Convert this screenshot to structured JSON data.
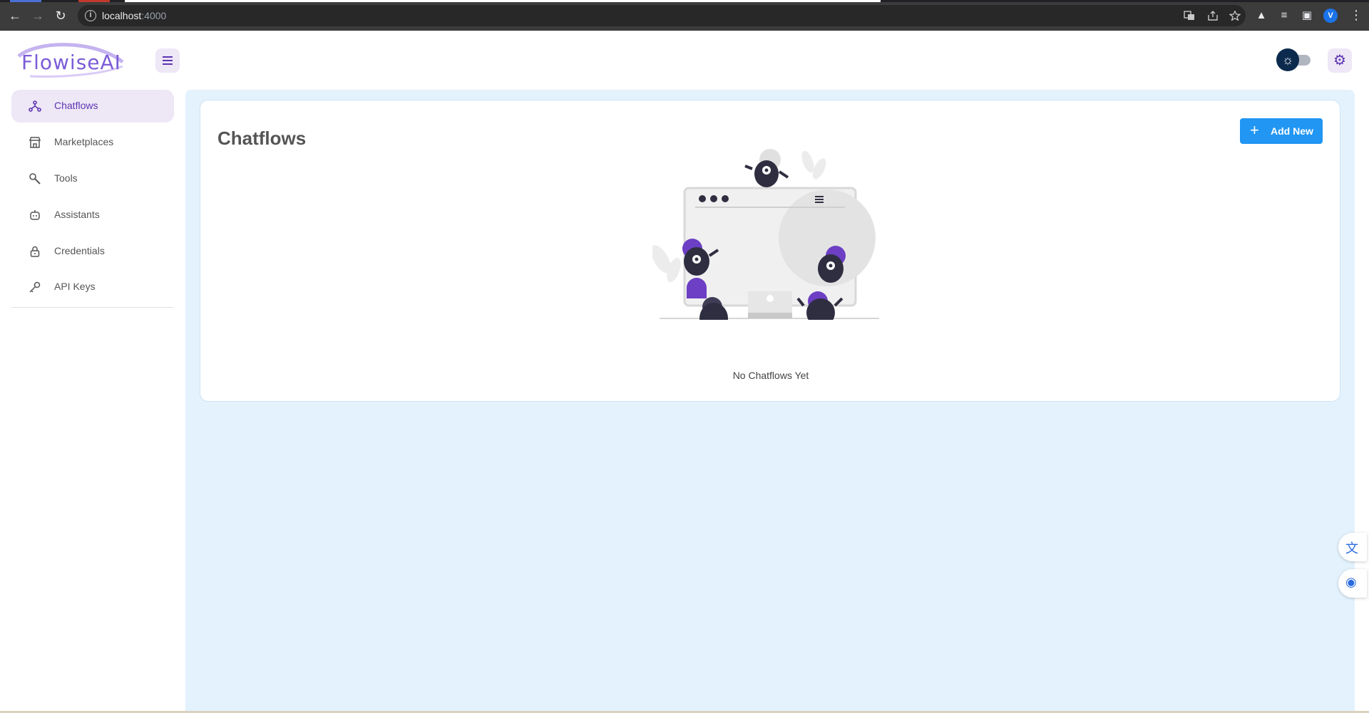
{
  "browser": {
    "url_host": "localhost",
    "url_port": ":4000",
    "profile_initial": "V"
  },
  "app": {
    "logo_text": "FlowiseAI",
    "accent_color": "#5e35b1",
    "primary_color": "#2196f3"
  },
  "sidebar": {
    "items": [
      {
        "label": "Chatflows",
        "icon": "chatflows-icon",
        "active": true
      },
      {
        "label": "Marketplaces",
        "icon": "marketplace-icon",
        "active": false
      },
      {
        "label": "Tools",
        "icon": "tools-icon",
        "active": false
      },
      {
        "label": "Assistants",
        "icon": "assistant-robot-icon",
        "active": false
      },
      {
        "label": "Credentials",
        "icon": "lock-icon",
        "active": false
      },
      {
        "label": "API Keys",
        "icon": "key-icon",
        "active": false
      }
    ]
  },
  "main": {
    "title": "Chatflows",
    "add_button_label": "Add New",
    "empty_message": "No Chatflows Yet"
  }
}
